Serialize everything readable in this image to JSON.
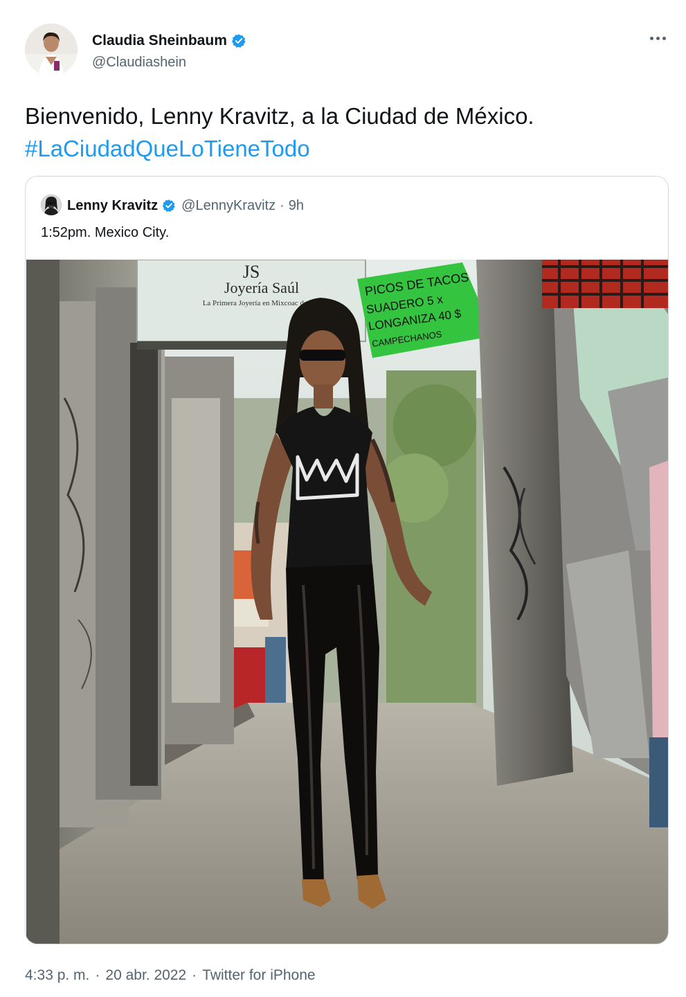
{
  "tweet": {
    "author_name": "Claudia Sheinbaum",
    "author_handle": "@Claudiashein",
    "text": "Bienvenido, Lenny Kravitz, a la Ciudad de México.",
    "hashtag": "#LaCiudadQueLoTieneTodo",
    "time": "4:33 p. m.",
    "separator": "·",
    "date": "20 abr. 2022",
    "source": "Twitter for iPhone",
    "more_icon": "ellipsis-icon",
    "verified_icon": "verified-badge-icon"
  },
  "quoted": {
    "author_name": "Lenny Kravitz",
    "author_handle": "@LennyKravitz",
    "separator": "·",
    "time_ago": "9h",
    "text": "1:52pm. Mexico City."
  },
  "photo_signs": {
    "shop_letters": "JS",
    "shop_name": "Joyería Saúl",
    "shop_tagline": "La Primera Joyería en Mixcoac desde 1975",
    "sign_green_1": "PICOS  DE   TACOS",
    "sign_green_2": "SUADERO    5 x",
    "sign_green_3": "LONGANIZA  40 $",
    "sign_green_4": "CAMPECHANOS"
  },
  "colors": {
    "accent": "#1d9bf0",
    "text": "#0f1419",
    "muted": "#536471",
    "border": "#cfd9de"
  }
}
